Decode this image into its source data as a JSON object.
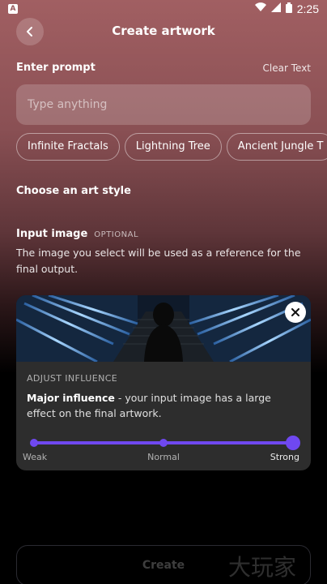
{
  "status": {
    "time": "2:25",
    "app_badge": "A"
  },
  "header": {
    "title": "Create artwork"
  },
  "prompt": {
    "label": "Enter prompt",
    "clear_label": "Clear Text",
    "placeholder": "Type anything"
  },
  "suggestions": [
    "Infinite Fractals",
    "Lightning Tree",
    "Ancient Jungle T"
  ],
  "art_style": {
    "label": "Choose an art style"
  },
  "input_image": {
    "label": "Input image",
    "optional": "OPTIONAL",
    "description": "The image you select will be used as a reference for the final output."
  },
  "influence": {
    "heading": "ADJUST INFLUENCE",
    "level_name": "Major influence",
    "level_desc": " - your input image has a large effect on the final artwork.",
    "stops": [
      "Weak",
      "Normal",
      "Strong"
    ],
    "selected_stop": 2
  },
  "create": {
    "label": "Create"
  },
  "watermark": "大玩家",
  "colors": {
    "accent": "#6f48f0",
    "card": "#2d2d2d"
  }
}
